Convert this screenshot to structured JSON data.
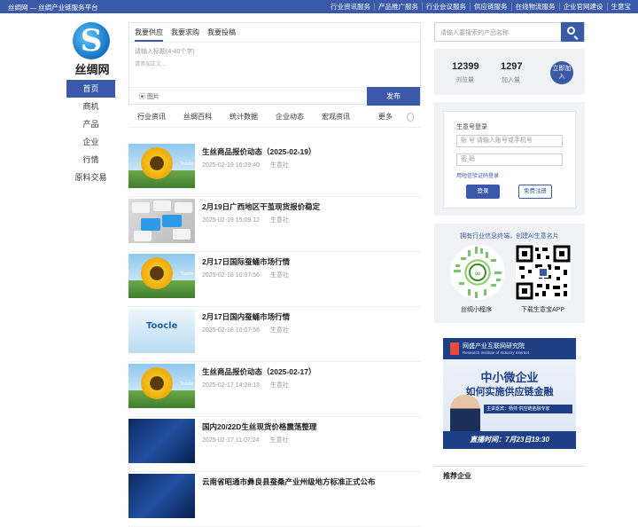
{
  "topbar": {
    "brand": "丝绸网 — 丝绸产业链服务平台",
    "links": [
      "行业资讯服务",
      "产品推广服务",
      "行业会议服务",
      "供应链服务",
      "在线物流服务",
      "企业官网建设",
      "生意宝"
    ]
  },
  "logo": {
    "text": "丝绸网",
    "glyph": "S"
  },
  "leftnav": [
    "首页",
    "商机",
    "产品",
    "企业",
    "行情",
    "原料交易"
  ],
  "post": {
    "tabs": [
      "我要供应",
      "我要求购",
      "我要投稿"
    ],
    "title_placeholder": "请输入标题(4-40个字)",
    "content_placeholder": "请添加正文...",
    "picture_label": "图片",
    "submit": "发布"
  },
  "categories": [
    "行业资讯",
    "丝绸百科",
    "统计数据",
    "企业动态",
    "宏观资讯"
  ],
  "more": "更多",
  "news": [
    {
      "title": "生丝商品报价动态（2025-02-19）",
      "time": "2025-02-19 16:29:40",
      "source": "生意社",
      "img": "sunflower"
    },
    {
      "title": "2月19日广西地区干茧现货报价稳定",
      "time": "2025-02-19 15:09:12",
      "source": "生意社",
      "img": "keys"
    },
    {
      "title": "2月17日国际蚕蛹市场行情",
      "time": "2025-02-18 10:07:56",
      "source": "生意社",
      "img": "sunflower"
    },
    {
      "title": "2月17日国内蚕蛹市场行情",
      "time": "2025-02-18 10:07:56",
      "source": "生意社",
      "img": "tocle"
    },
    {
      "title": "生丝商品报价动态（2025-02-17）",
      "time": "2025-02-17 14:28:18",
      "source": "生意社",
      "img": "sunflower"
    },
    {
      "title": "国内20/22D生丝现货价格震荡整理",
      "time": "2025-02-17 11:07:24",
      "source": "生意社",
      "img": "tech"
    },
    {
      "title": "云南省昭通市彝良县蚕桑产业州级地方标准正式公布",
      "time": "",
      "source": "",
      "img": "tech"
    }
  ],
  "thumb_label": "Toocle",
  "search": {
    "placeholder": "请输入要搜索的产品名称"
  },
  "stats": {
    "views": "12399",
    "views_label": "浏览量",
    "joined": "1297",
    "joined_label": "加入量",
    "join_btn": "立即加入"
  },
  "login": {
    "heading": "生意号登录",
    "account_placeholder": "账  号   请输入账号或手机号",
    "password_placeholder": "密  码",
    "sms": "用短信验证码登录",
    "login_btn": "登录",
    "register_btn": "免费注册"
  },
  "qr": {
    "heading": "拥有行业信息终端，创建AI生意名片",
    "left_caption": "丝绸小程序",
    "right_caption": "下载生意宝APP"
  },
  "banner": {
    "org": "网盛产业互联网研究院",
    "org_en": "Research Institute of Industry Internet",
    "line1": "中小微企业",
    "line2": "如何实施供应链金融",
    "speaker": "主讲嘉宾：杨帅  供应链金融专家",
    "foot": "直播时间：7月23日19:30"
  },
  "recommend": "推荐企业"
}
